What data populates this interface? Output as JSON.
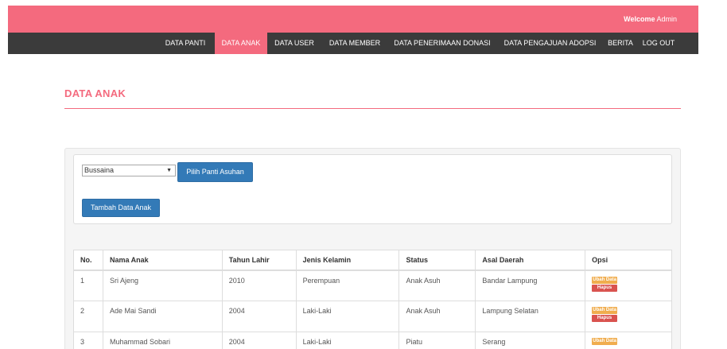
{
  "header": {
    "welcome_label": "Welcome",
    "user_name": "Admin"
  },
  "nav": {
    "items": [
      {
        "label": "DATA PANTI"
      },
      {
        "label": "DATA ANAK",
        "active": true
      },
      {
        "label": "DATA USER"
      },
      {
        "label": "DATA MEMBER"
      },
      {
        "label": "DATA PENERIMAAN DONASI"
      },
      {
        "label": "DATA PENGAJUAN ADOPSI"
      },
      {
        "label": "BERITA"
      },
      {
        "label": "LOG OUT"
      }
    ]
  },
  "page": {
    "title": "DATA ANAK"
  },
  "controls": {
    "panti_select": "Bussaina",
    "pilih_button": "Pilih Panti Asuhan",
    "tambah_button": "Tambah Data Anak"
  },
  "table": {
    "headers": [
      "No.",
      "Nama Anak",
      "Tahun Lahir",
      "Jenis Kelamin",
      "Status",
      "Asal Daerah",
      "Opsi"
    ],
    "rows": [
      {
        "no": "1",
        "nama": "Sri Ajeng",
        "tahun": "2010",
        "jenis": "Perempuan",
        "status": "Anak Asuh",
        "asal": "Bandar Lampung"
      },
      {
        "no": "2",
        "nama": "Ade Mai Sandi",
        "tahun": "2004",
        "jenis": "Laki-Laki",
        "status": "Anak Asuh",
        "asal": "Lampung Selatan"
      },
      {
        "no": "3",
        "nama": "Muhammad Sobari",
        "tahun": "2004",
        "jenis": "Laki-Laki",
        "status": "Piatu",
        "asal": "Serang"
      }
    ],
    "edit_label": "Ubah Data",
    "delete_label": "Hapus Data"
  },
  "colors": {
    "accent": "#f46a7e",
    "nav_bg": "#3b3b3b",
    "primary": "#337ab7",
    "warning": "#f0ad4e",
    "danger": "#d9534f"
  }
}
